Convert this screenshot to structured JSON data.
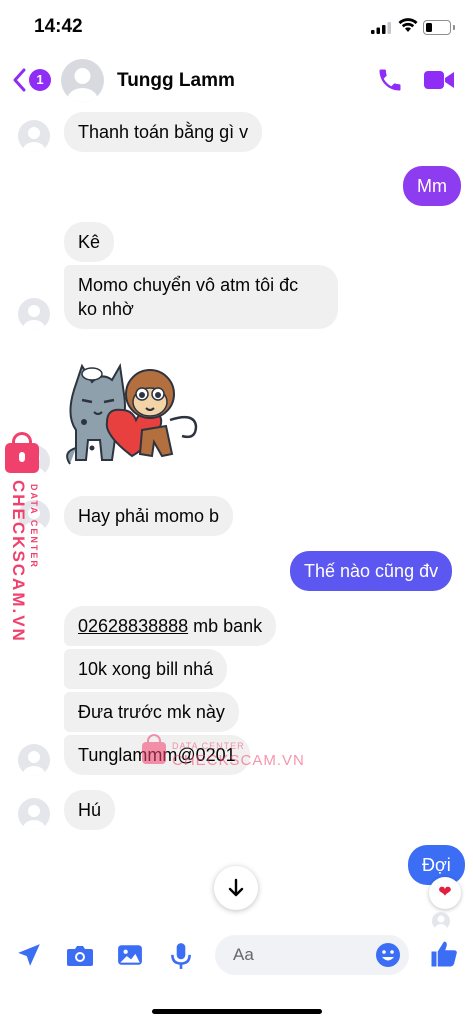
{
  "status_bar": {
    "time": "14:42"
  },
  "header": {
    "back_count": "1",
    "contact_name": "Tungg Lamm"
  },
  "messages": {
    "m1": "Thanh toán bằng gì v",
    "m2": "Mm",
    "m3": "Kê",
    "m4_line1": "Momo chuyển vô atm tôi đc",
    "m4_line2": "ko nhờ",
    "m5": "Hay phải momo b",
    "m6": "Thế nào cũng đv",
    "m7_number": "02628838888",
    "m7_rest": " mb bank",
    "m8": "10k xong bill nhá",
    "m9": "Đưa trước mk này",
    "m10": "Tunglammm@0201",
    "m11": "Hú",
    "m12": "Đợi"
  },
  "reaction": "❤",
  "composer": {
    "placeholder": "Aa"
  },
  "watermark": {
    "brand": "CHECKSCAM.VN",
    "tag": "DATA CENTER"
  },
  "colors": {
    "accent": "#8f2cf5",
    "out_bubble_purple": "#8d3cf0",
    "out_bubble_indigo": "#5b57f0",
    "out_bubble_blue": "#3b6ef5",
    "in_bubble": "#f0f0f0",
    "watermark": "#f0406c"
  },
  "icons": [
    "back-chevron-icon",
    "phone-icon",
    "video-camera-icon",
    "arrow-down-icon",
    "send-location-icon",
    "camera-icon",
    "image-icon",
    "microphone-icon",
    "emoji-icon",
    "thumbs-up-icon",
    "heart-icon"
  ]
}
